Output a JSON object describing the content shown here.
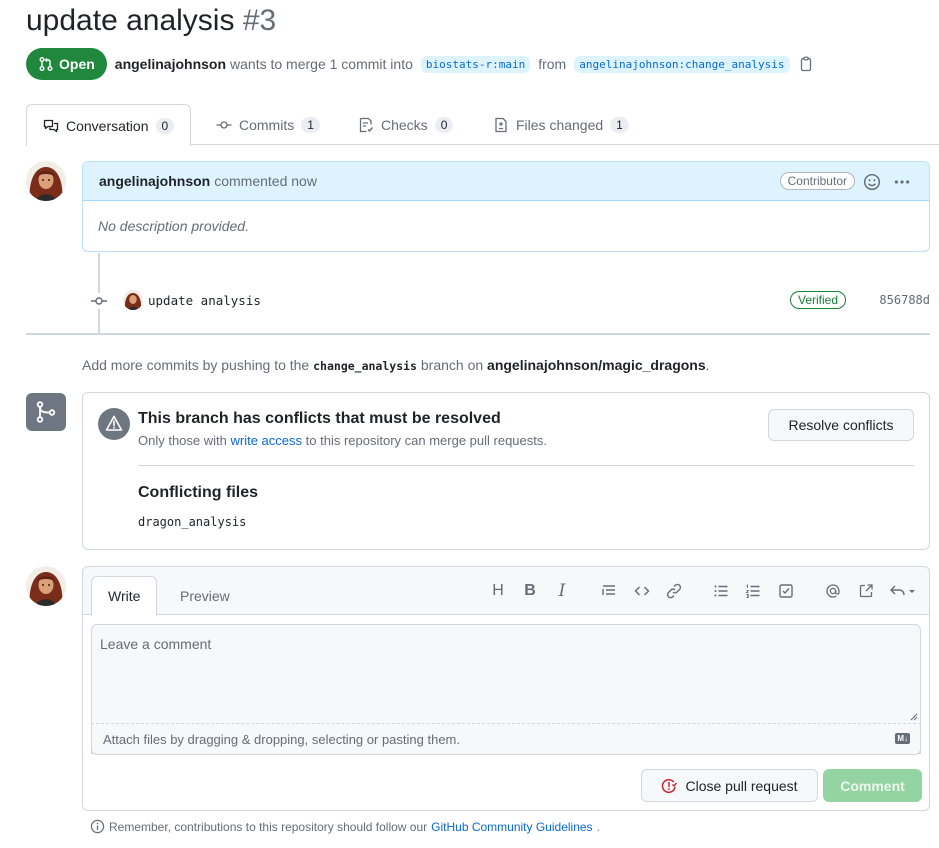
{
  "pr": {
    "title": "update analysis",
    "number": "#3",
    "state": "Open",
    "author": "angelinajohnson",
    "merge_text": "wants to merge 1 commit into",
    "base_branch": "biostats-r:main",
    "from_text": "from",
    "head_branch": "angelinajohnson:change_analysis"
  },
  "tabs": [
    {
      "label": "Conversation",
      "count": "0"
    },
    {
      "label": "Commits",
      "count": "1"
    },
    {
      "label": "Checks",
      "count": "0"
    },
    {
      "label": "Files changed",
      "count": "1"
    }
  ],
  "comment": {
    "author": "angelinajohnson",
    "action": "commented now",
    "badge": "Contributor",
    "body": "No description provided."
  },
  "commit": {
    "message": "update analysis",
    "verified": "Verified",
    "sha": "856788d"
  },
  "hint": {
    "prefix": "Add more commits by pushing to the",
    "branch": "change_analysis",
    "middle": "branch on",
    "repo": "angelinajohnson/magic_dragons",
    "suffix": "."
  },
  "merge": {
    "title": "This branch has conflicts that must be resolved",
    "subtitle_prefix": "Only those with",
    "subtitle_link": "write access",
    "subtitle_suffix": "to this repository can merge pull requests.",
    "resolve_button": "Resolve conflicts",
    "conflicting_title": "Conflicting files",
    "conflicting_file": "dragon_analysis"
  },
  "editor": {
    "write_tab": "Write",
    "preview_tab": "Preview",
    "placeholder": "Leave a comment",
    "attach_text": "Attach files by dragging & dropping, selecting or pasting them.",
    "close_button": "Close pull request",
    "comment_button": "Comment",
    "md_badge": "M↓"
  },
  "footer": {
    "prefix": "Remember, contributions to this repository should follow our",
    "link": "GitHub Community Guidelines",
    "suffix": "."
  },
  "colors": {
    "open_green": "#1f883d",
    "link_blue": "#0969da",
    "comment_button_disabled": "#94d3a2"
  }
}
